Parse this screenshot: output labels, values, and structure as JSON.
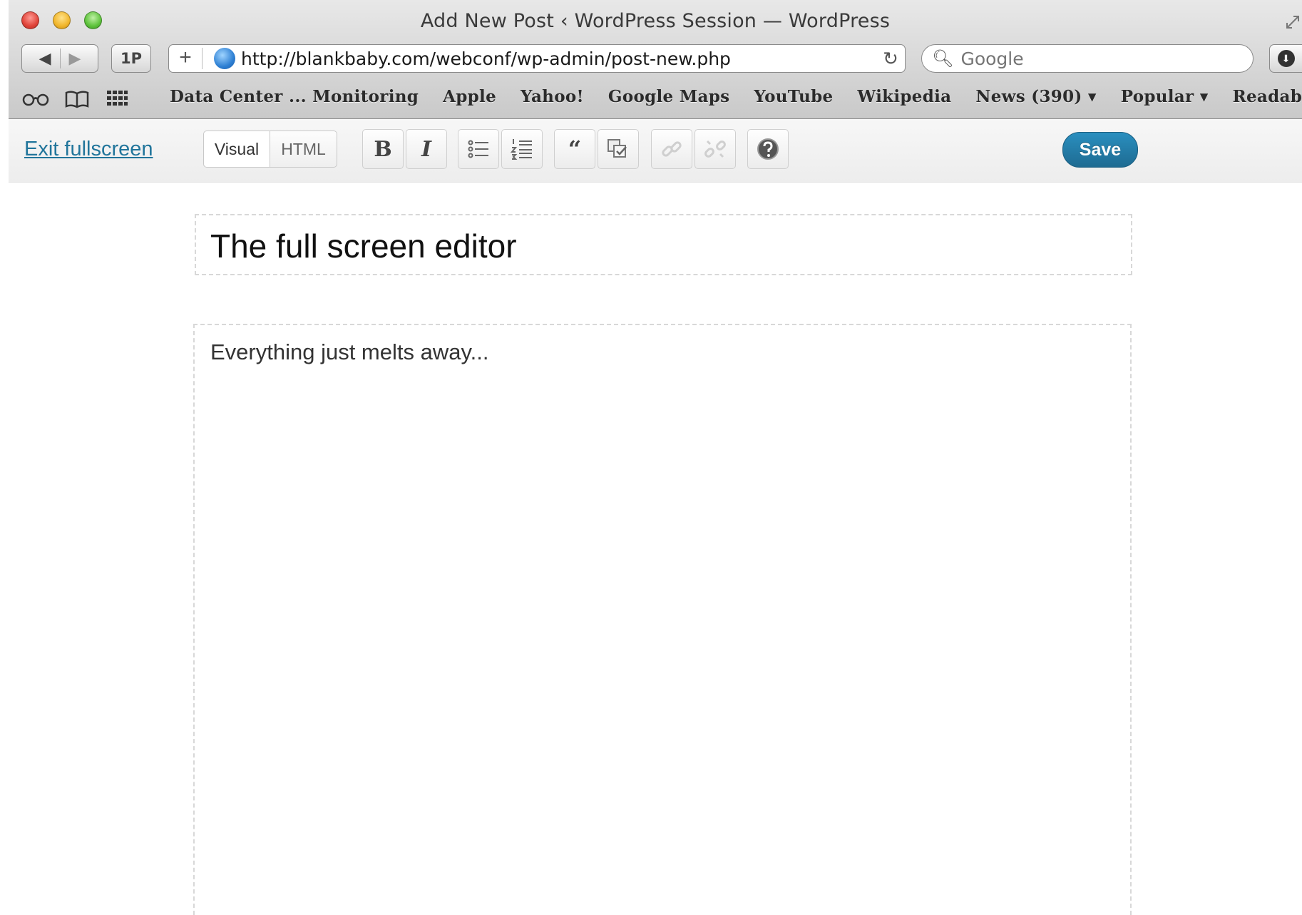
{
  "window": {
    "title": "Add New Post ‹ WordPress Session — WordPress"
  },
  "browser": {
    "onep_label": "1P",
    "url": "http://blankbaby.com/webconf/wp-admin/post-new.php",
    "search_placeholder": "Google",
    "bookmarks": [
      "Data Center ... Monitoring",
      "Apple",
      "Yahoo!",
      "Google Maps",
      "YouTube",
      "Wikipedia",
      "News (390) ▾",
      "Popular ▾",
      "Readable"
    ]
  },
  "editor_toolbar": {
    "exit_label": "Exit fullscreen",
    "visual_label": "Visual",
    "html_label": "HTML",
    "bold_label": "B",
    "italic_label": "I",
    "quote_label": "“",
    "save_label": "Save"
  },
  "post": {
    "title": "The full screen editor",
    "content": "Everything just melts away..."
  },
  "colors": {
    "link": "#21759b",
    "save_button": "#21759b"
  },
  "icons": [
    "back-icon",
    "forward-icon",
    "add-tab-icon",
    "globe-icon",
    "reload-icon",
    "search-icon",
    "download-icon",
    "reading-list-icon",
    "bookmarks-icon",
    "top-sites-icon",
    "bullet-list-icon",
    "numbered-list-icon",
    "blockquote-icon",
    "spellcheck-icon",
    "link-icon",
    "unlink-icon",
    "help-icon"
  ]
}
